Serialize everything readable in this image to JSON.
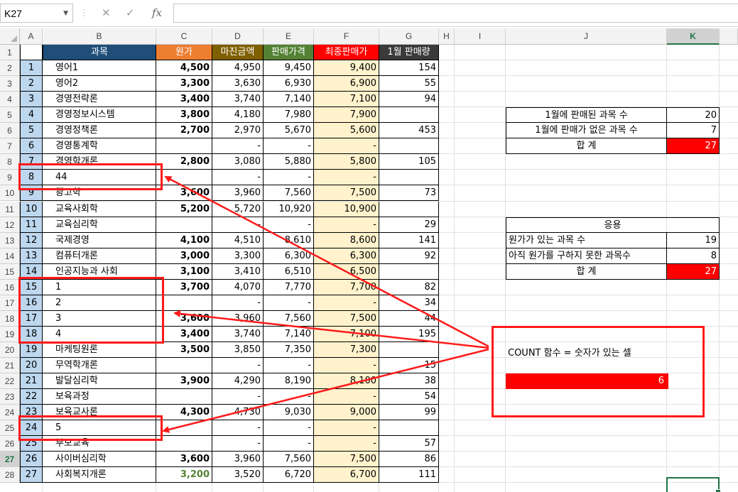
{
  "formula_bar": {
    "name_box": "K27",
    "formula": "",
    "icons": [
      "cancel-icon",
      "enter-icon",
      "function-icon"
    ]
  },
  "columns": [
    "A",
    "B",
    "C",
    "D",
    "E",
    "F",
    "G",
    "H",
    "I",
    "J",
    "K"
  ],
  "selected_column": "K",
  "selected_row": 27,
  "table": {
    "headers": [
      {
        "label": "과목",
        "bg": "#1f4e79"
      },
      {
        "label": "원가",
        "bg": "#ed7d31"
      },
      {
        "label": "마진금액",
        "bg": "#7f6000"
      },
      {
        "label": "판매가격",
        "bg": "#548235"
      },
      {
        "label": "최종판매가",
        "bg": "#ff0000"
      },
      {
        "label": "1월 판매량",
        "bg": "#3a3a3a"
      }
    ],
    "rows": [
      [
        "1",
        "영어1",
        "4,500",
        "4,950",
        "9,450",
        "9,400",
        "154"
      ],
      [
        "2",
        "영어2",
        "3,300",
        "3,630",
        "6,930",
        "6,900",
        "55"
      ],
      [
        "3",
        "경영전략론",
        "3,400",
        "3,740",
        "7,140",
        "7,100",
        "94"
      ],
      [
        "4",
        "경영정보시스템",
        "3,800",
        "4,180",
        "7,980",
        "7,900",
        ""
      ],
      [
        "5",
        "경영정책론",
        "2,700",
        "2,970",
        "5,670",
        "5,600",
        "453"
      ],
      [
        "6",
        "경영통계학",
        "",
        "-",
        "-",
        "-",
        ""
      ],
      [
        "7",
        "경영학개론",
        "2,800",
        "3,080",
        "5,880",
        "5,800",
        "105"
      ],
      [
        "8",
        "44",
        "",
        "-",
        "-",
        "-",
        ""
      ],
      [
        "9",
        "광고학",
        "3,600",
        "3,960",
        "7,560",
        "7,500",
        "73"
      ],
      [
        "10",
        "교육사회학",
        "5,200",
        "5,720",
        "10,920",
        "10,900",
        ""
      ],
      [
        "11",
        "교육심리학",
        "",
        "-",
        "-",
        "-",
        "29"
      ],
      [
        "12",
        "국제경영",
        "4,100",
        "4,510",
        "8,610",
        "8,600",
        "141"
      ],
      [
        "13",
        "컴퓨터개론",
        "3,000",
        "3,300",
        "6,300",
        "6,300",
        "92"
      ],
      [
        "14",
        "인공지능과 사회",
        "3,100",
        "3,410",
        "6,510",
        "6,500",
        ""
      ],
      [
        "15",
        "1",
        "3,700",
        "4,070",
        "7,770",
        "7,700",
        "82"
      ],
      [
        "16",
        "2",
        "",
        "-",
        "-",
        "-",
        "34"
      ],
      [
        "17",
        "3",
        "3,600",
        "3,960",
        "7,560",
        "7,500",
        "44"
      ],
      [
        "18",
        "4",
        "3,400",
        "3,740",
        "7,140",
        "7,100",
        "195"
      ],
      [
        "19",
        "마케팅원론",
        "3,500",
        "3,850",
        "7,350",
        "7,300",
        ""
      ],
      [
        "20",
        "무역학개론",
        "",
        "-",
        "-",
        "-",
        "15"
      ],
      [
        "21",
        "발달심리학",
        "3,900",
        "4,290",
        "8,190",
        "8,100",
        "38"
      ],
      [
        "22",
        "보육과정",
        "",
        "-",
        "-",
        "-",
        "54"
      ],
      [
        "23",
        "보육교사론",
        "4,300",
        "4,730",
        "9,030",
        "9,000",
        "99"
      ],
      [
        "24",
        "5",
        "",
        "-",
        "-",
        "-",
        ""
      ],
      [
        "25",
        "부모교육",
        "",
        "-",
        "-",
        "-",
        "57"
      ],
      [
        "26",
        "사이버심리학",
        "3,600",
        "3,960",
        "7,560",
        "7,500",
        "86"
      ],
      [
        "27",
        "사회복지개론",
        "3,200",
        "3,520",
        "6,720",
        "6,700",
        "111"
      ]
    ],
    "highlight_col_bg": "#fff2cc",
    "green_value_color": "#548235"
  },
  "summary1": {
    "rows": [
      {
        "label": "1월에 판매된 과목 수",
        "value": "20"
      },
      {
        "label": "1월에 판매가 없은 과목 수",
        "value": "7"
      },
      {
        "label": "합 계",
        "value": "27"
      }
    ]
  },
  "summary2": {
    "title": "응용",
    "rows": [
      {
        "label": "원가가 있는 과목 수",
        "value": "19"
      },
      {
        "label": "아직 원가를 구하지 못한 과목수",
        "value": "8"
      },
      {
        "label": "합 계",
        "value": "27"
      }
    ]
  },
  "callout": {
    "text": "COUNT 함수 = 숫자가 있는 셀",
    "result": "6"
  },
  "accent_red": "#ff0000",
  "excel_green": "#217346"
}
